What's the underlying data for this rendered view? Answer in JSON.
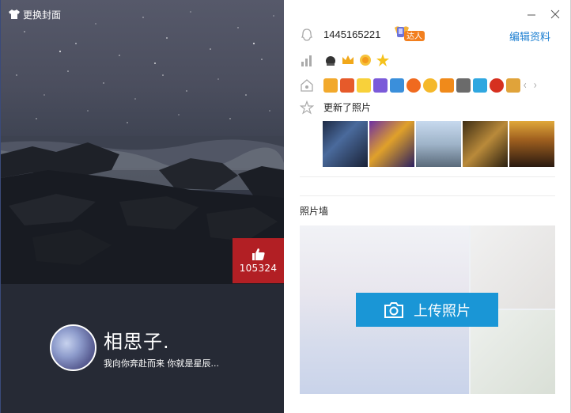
{
  "window": {
    "minimize_label": "minimize",
    "close_label": "close"
  },
  "cover": {
    "change_cover_label": "更换封面",
    "like_count": "105324"
  },
  "profile": {
    "nickname": "相思子.",
    "signature": "我向你奔赴而来 你就是星辰..."
  },
  "info": {
    "qq_number": "1445165221",
    "daren_badge_text": "达人",
    "edit_profile_label": "编辑资料",
    "level_icons": [
      "level-sun-icon",
      "crown-icon",
      "sun-icon",
      "star-icon"
    ],
    "vip_badges": [
      "badge-1",
      "badge-2",
      "badge-3",
      "badge-4",
      "badge-5",
      "badge-6",
      "badge-7",
      "badge-8",
      "badge-9",
      "badge-10",
      "badge-11",
      "badge-12",
      "badge-13"
    ],
    "update_text": "更新了照片",
    "recent_photos": [
      "photo-1",
      "photo-2",
      "photo-3",
      "photo-4",
      "photo-5"
    ]
  },
  "photo_wall": {
    "title": "照片墙",
    "upload_label": "上传照片"
  },
  "colors": {
    "accent_blue": "#1a96d6",
    "link_blue": "#1a7ed1",
    "like_red": "#b21f24",
    "dark_panel": "#262a35"
  }
}
